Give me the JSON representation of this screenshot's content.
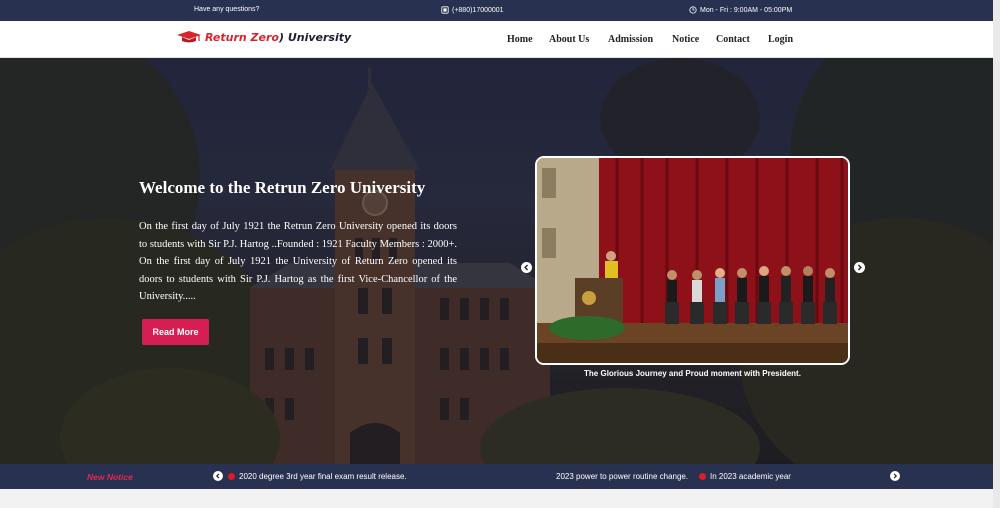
{
  "topbar": {
    "question": "Have any questions?",
    "phone": "(+880)17000001",
    "hours": "Mon - Fri : 9:00AM - 05:00PM"
  },
  "navbar": {
    "logo_part1": "Return Zero",
    "logo_part2": ") University",
    "links": [
      "Home",
      "About Us",
      "Admission",
      "Notice",
      "Contact",
      "Login"
    ]
  },
  "hero": {
    "title": "Welcome to the Retrun Zero University",
    "paragraph": "On the first day of July 1921 the Retrun Zero University opened its doors to students with Sir P.J. Hartog ..Founded : 1921 Faculty Members : 2000+. On the first day of July 1921 the University of Return Zero opened its doors to students with Sir P.J. Hartog as the first Vice-Chancellor of the University.....",
    "button": "Read More",
    "slider_caption": "The Glorious Journey and Proud moment with President."
  },
  "notice": {
    "label": "New Notice",
    "items": [
      "2020 degree 3rd year final exam result release.",
      "2023 power to power routine change.",
      "In 2023 academic year"
    ]
  },
  "colors": {
    "navy": "#283150",
    "accent_red": "#d51f52",
    "notice_red": "#e0284f"
  },
  "icons": [
    "phone-icon",
    "clock-icon",
    "graduation-cap-icon",
    "chevron-left-icon",
    "chevron-right-icon"
  ]
}
